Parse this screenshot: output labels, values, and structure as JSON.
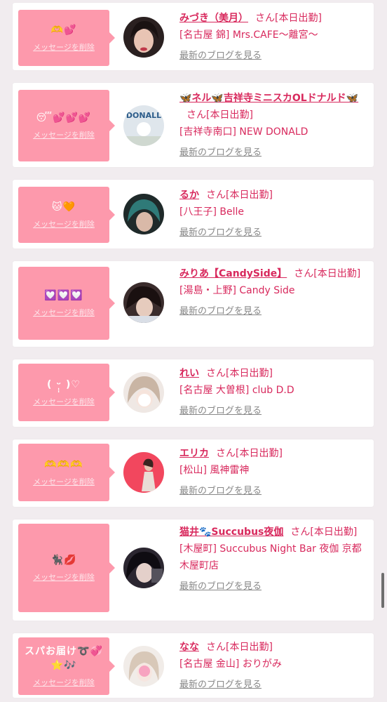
{
  "delete_label": "メッセージを削除",
  "blog_label": "最新のブログを見る",
  "san_label": "さん[本日出勤]",
  "accent_color": "#d8295d",
  "message_bg": "#fd99ac",
  "entries": [
    {
      "message": "🫶💕",
      "name": "みづき（美月）",
      "shop": "[名古屋 錦] Mrs.CAFE〜離宮〜",
      "avatar_icon": "woman-portrait"
    },
    {
      "message": "😴💕💕💕",
      "name": "🦋ネル🦋吉祥寺ミニスカOLドナルド🦋",
      "shop": "[吉祥寺南口] NEW DONALD",
      "avatar_icon": "donald-logo"
    },
    {
      "message": "🐱🧡",
      "name": "るか",
      "shop": "[八王子] Belle",
      "avatar_icon": "teal-hair-portrait"
    },
    {
      "message": "💟💟💟",
      "name": "みりあ【CandySide】",
      "shop": "[湯島・上野] Candy Side",
      "avatar_icon": "selfie-portrait"
    },
    {
      "message": "( ᵕ̩̩ )♡",
      "name": "れい",
      "shop": "[名古屋 大曽根] club D.D",
      "avatar_icon": "blonde-portrait"
    },
    {
      "message": "🫶🫶🫶",
      "name": "エリカ",
      "shop": "[松山] 風神雷神",
      "avatar_icon": "pink-background-portrait"
    },
    {
      "message": "🐈‍⬛💋",
      "name": "猫井🐾Succubus夜伽",
      "shop": "[木屋町] Succubus Night Bar 夜伽 京都木屋町店",
      "avatar_icon": "dark-hair-portrait"
    },
    {
      "message": "スパお届け➰💞\n⭐️🎶",
      "name": "なな",
      "shop": "[名古屋 金山] おりがみ",
      "avatar_icon": "light-hair-portrait"
    }
  ]
}
